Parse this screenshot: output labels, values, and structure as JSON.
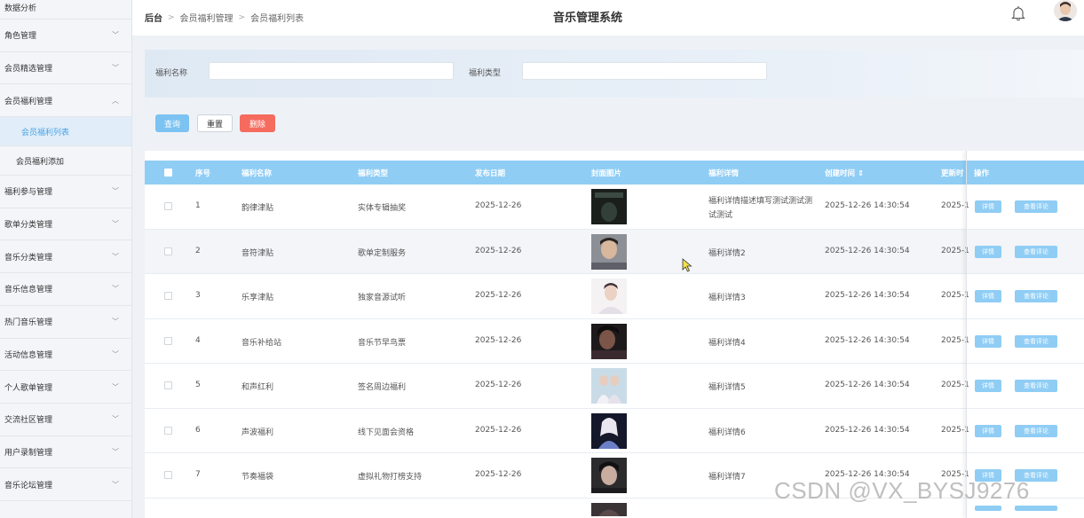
{
  "sidebar": {
    "top_label": "数据分析",
    "items": [
      {
        "label": "角色管理"
      },
      {
        "label": "会员精选管理"
      },
      {
        "label": "会员福利管理",
        "expanded": true,
        "children": [
          {
            "label": "会员福利列表",
            "active": true
          },
          {
            "label": "会员福利添加"
          }
        ]
      },
      {
        "label": "福利参与管理"
      },
      {
        "label": "歌单分类管理"
      },
      {
        "label": "音乐分类管理"
      },
      {
        "label": "音乐信息管理"
      },
      {
        "label": "热门音乐管理"
      },
      {
        "label": "活动信息管理"
      },
      {
        "label": "个人歌单管理"
      },
      {
        "label": "交流社区管理"
      },
      {
        "label": "用户录制管理"
      },
      {
        "label": "音乐论坛管理"
      }
    ]
  },
  "header": {
    "breadcrumb": [
      "后台",
      "会员福利管理",
      "会员福利列表"
    ],
    "title": "音乐管理系统"
  },
  "search": {
    "name_label": "福利名称",
    "name_value": "",
    "type_label": "福利类型",
    "type_value": ""
  },
  "buttons": {
    "query": "查询",
    "reset": "重置",
    "delete": "删除"
  },
  "table": {
    "columns": [
      "序号",
      "福利名称",
      "福利类型",
      "发布日期",
      "封面图片",
      "福利详情",
      "创建时间 ⇕",
      "更新时",
      "操作"
    ],
    "op_detail": "详情",
    "op_comment": "查看评论",
    "rows": [
      {
        "no": "1",
        "name": "韵律津贴",
        "type": "实体专辑抽奖",
        "date": "2025-12-26",
        "detail": "福利详情描述填写测试测试测试测试",
        "created": "2025-12-26 14:30:54",
        "updated": "2025-1"
      },
      {
        "no": "2",
        "name": "音符津贴",
        "type": "歌单定制服务",
        "date": "2025-12-26",
        "detail": "福利详情2",
        "created": "2025-12-26 14:30:54",
        "updated": "2025-1"
      },
      {
        "no": "3",
        "name": "乐享津贴",
        "type": "独家音源试听",
        "date": "2025-12-26",
        "detail": "福利详情3",
        "created": "2025-12-26 14:30:54",
        "updated": "2025-1"
      },
      {
        "no": "4",
        "name": "音乐补给站",
        "type": "音乐节早鸟票",
        "date": "2025-12-26",
        "detail": "福利详情4",
        "created": "2025-12-26 14:30:54",
        "updated": "2025-1"
      },
      {
        "no": "5",
        "name": "和声红利",
        "type": "签名周边福利",
        "date": "2025-12-26",
        "detail": "福利详情5",
        "created": "2025-12-26 14:30:54",
        "updated": "2025-1"
      },
      {
        "no": "6",
        "name": "声波福利",
        "type": "线下见面会资格",
        "date": "2025-12-26",
        "detail": "福利详情6",
        "created": "2025-12-26 14:30:54",
        "updated": "2025-1"
      },
      {
        "no": "7",
        "name": "节奏福袋",
        "type": "虚拟礼物打榜支持",
        "date": "2025-12-26",
        "detail": "福利详情7",
        "created": "2025-12-26 14:30:54",
        "updated": "2025-1"
      }
    ]
  },
  "watermark": "CSDN @VX_BYSJ9276",
  "colors": {
    "accent": "#8fcdf5",
    "danger": "#f56c5f",
    "active_text": "#4aa3e6"
  }
}
